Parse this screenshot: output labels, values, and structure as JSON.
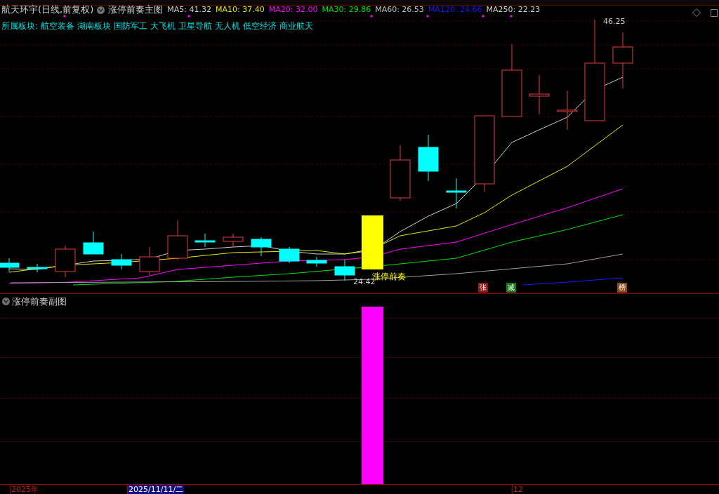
{
  "stock_title": "航天环宇(日线,前复权)",
  "main_indicator": {
    "title": "涨停前奏主图",
    "ma_readings": [
      {
        "label": "MA5: 41.32",
        "color": "#d0d0d0"
      },
      {
        "label": "MA10: 37.40",
        "color": "#e8e800"
      },
      {
        "label": "MA20: 32.00",
        "color": "#ff00ff"
      },
      {
        "label": "MA30: 29.86",
        "color": "#00e000"
      },
      {
        "label": "MA60: 26.53",
        "color": "#c0c0c0"
      },
      {
        "label": "MA120: 24.66",
        "color": "#1a1aff"
      },
      {
        "label": "MA250: 22.23",
        "color": "#d0d0d0"
      }
    ]
  },
  "sector": {
    "label": "所属板块:",
    "items": [
      "航空装备",
      "湖南板块",
      "国防军工",
      "大飞机",
      "卫星导航",
      "无人机",
      "低空经济",
      "商业航天"
    ]
  },
  "price_annotations": {
    "high": "46.25",
    "low": "24.42",
    "signal": "涨停前奏"
  },
  "markers": [
    {
      "text": "张",
      "color": "#8b1a1a"
    },
    {
      "text": "减",
      "color": "#1a7a1a"
    },
    {
      "text": "榜",
      "color": "#8b4a1a"
    }
  ],
  "sub_indicator": {
    "title": "涨停前奏副图"
  },
  "time_axis": [
    {
      "text": "2025年",
      "selected": false
    },
    {
      "text": "2025/11/11/二",
      "selected": true
    },
    {
      "text": "12",
      "selected": false
    }
  ]
}
